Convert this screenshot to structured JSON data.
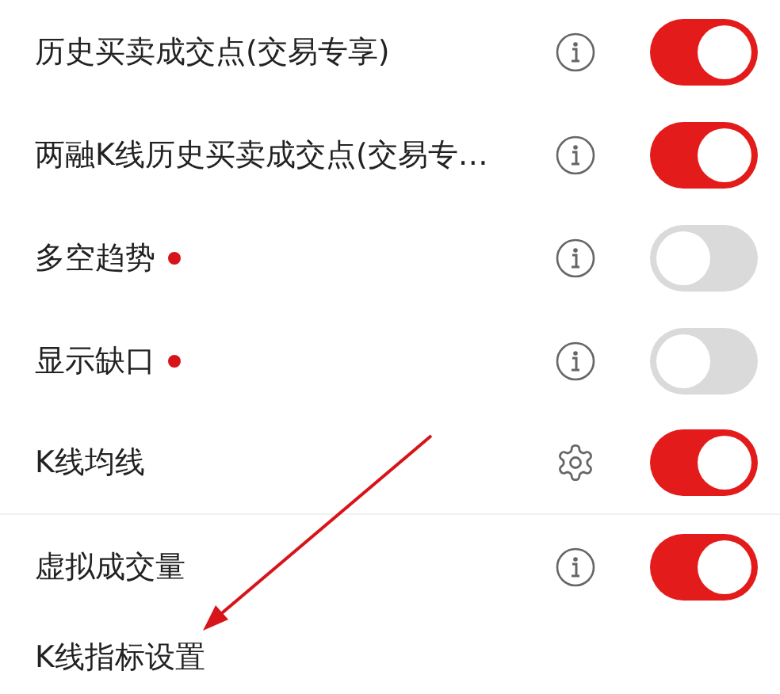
{
  "settings": [
    {
      "label": "历史买卖成交点(交易专享)",
      "dot": false,
      "kind": "info",
      "on": true
    },
    {
      "label": "两融K线历史买卖成交点(交易专…",
      "dot": false,
      "kind": "info",
      "on": true
    },
    {
      "label": "多空趋势",
      "dot": true,
      "kind": "info",
      "on": false
    },
    {
      "label": "显示缺口",
      "dot": true,
      "kind": "info",
      "on": false
    },
    {
      "label": "K线均线",
      "dot": false,
      "kind": "gear",
      "on": true
    },
    {
      "label": "虚拟成交量",
      "dot": false,
      "kind": "info",
      "on": true
    }
  ],
  "section_header": "K线指标设置"
}
